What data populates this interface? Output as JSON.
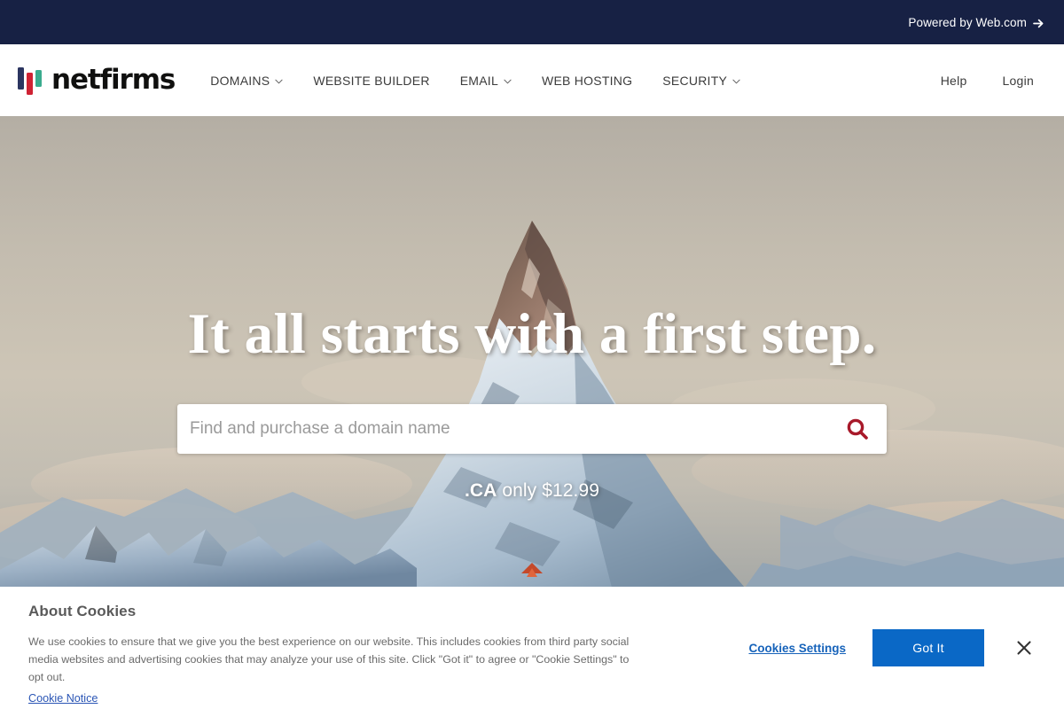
{
  "topbar": {
    "powered_by_label": "Powered by Web.com",
    "arrow_icon": "arrow-right-icon",
    "background_color": "#172144"
  },
  "header": {
    "logo": {
      "wordmark": "netfirms",
      "mark_icon": "netfirms-bars-logo",
      "bar_colors": [
        "#2b3560",
        "#cf2233",
        "#3aab8e"
      ]
    },
    "nav": [
      {
        "label": "DOMAINS",
        "has_chevron": true
      },
      {
        "label": "WEBSITE BUILDER",
        "has_chevron": false
      },
      {
        "label": "EMAIL",
        "has_chevron": true
      },
      {
        "label": "WEB HOSTING",
        "has_chevron": false
      },
      {
        "label": "SECURITY",
        "has_chevron": true
      }
    ],
    "right_links": [
      {
        "label": "Help"
      },
      {
        "label": "Login"
      }
    ]
  },
  "hero": {
    "title": "It all starts with a first step.",
    "search": {
      "placeholder": "Find and purchase a domain name",
      "value": "",
      "button_icon": "search-icon",
      "icon_color": "#a8192a"
    },
    "promo": {
      "tld": ".CA",
      "text": " only $12.99"
    }
  },
  "cookie_banner": {
    "title": "About Cookies",
    "body": "We use cookies to ensure that we give you the best experience on our website. This includes cookies from third party social media websites and advertising cookies that may analyze your use of this site. Click \"Got it\" to agree or \"Cookie Settings\" to opt out.",
    "notice_link": "Cookie Notice",
    "settings_link": "Cookies Settings",
    "accept_label": "Got It",
    "close_icon": "close-icon",
    "accept_color": "#0a68c6"
  }
}
